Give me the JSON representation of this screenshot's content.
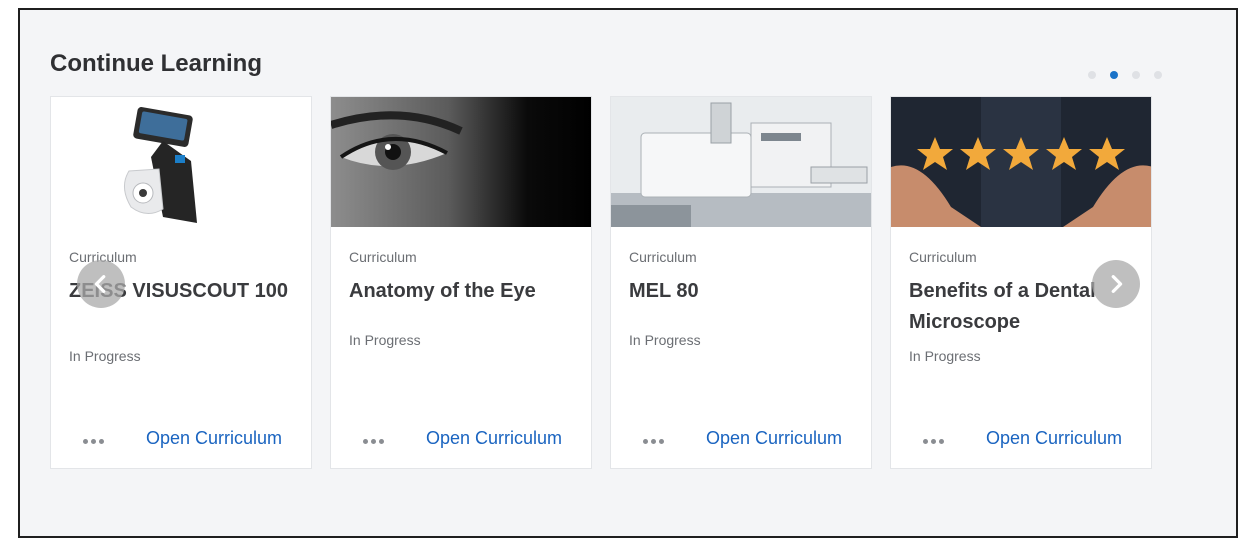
{
  "section": {
    "title": "Continue Learning"
  },
  "pagination": {
    "count": 4,
    "active_index": 1
  },
  "cards": [
    {
      "type": "Curriculum",
      "title": "ZEISS VISUSCOUT 100",
      "status": "In Progress",
      "action": "Open Curriculum",
      "image": "handheld-fundus-camera"
    },
    {
      "type": "Curriculum",
      "title": "Anatomy of the Eye",
      "status": "In Progress",
      "action": "Open Curriculum",
      "image": "eye-closeup"
    },
    {
      "type": "Curriculum",
      "title": "MEL 80",
      "status": "In Progress",
      "action": "Open Curriculum",
      "image": "laser-system"
    },
    {
      "type": "Curriculum",
      "title": "Benefits of a Dental Microscope",
      "status": "In Progress",
      "action": "Open Curriculum",
      "image": "five-stars-hands"
    }
  ],
  "icons": {
    "prev": "chevron-left-icon",
    "next": "chevron-right-icon",
    "more": "more-dots-icon"
  },
  "colors": {
    "accent": "#1a73c8",
    "link": "#1a64c0"
  }
}
